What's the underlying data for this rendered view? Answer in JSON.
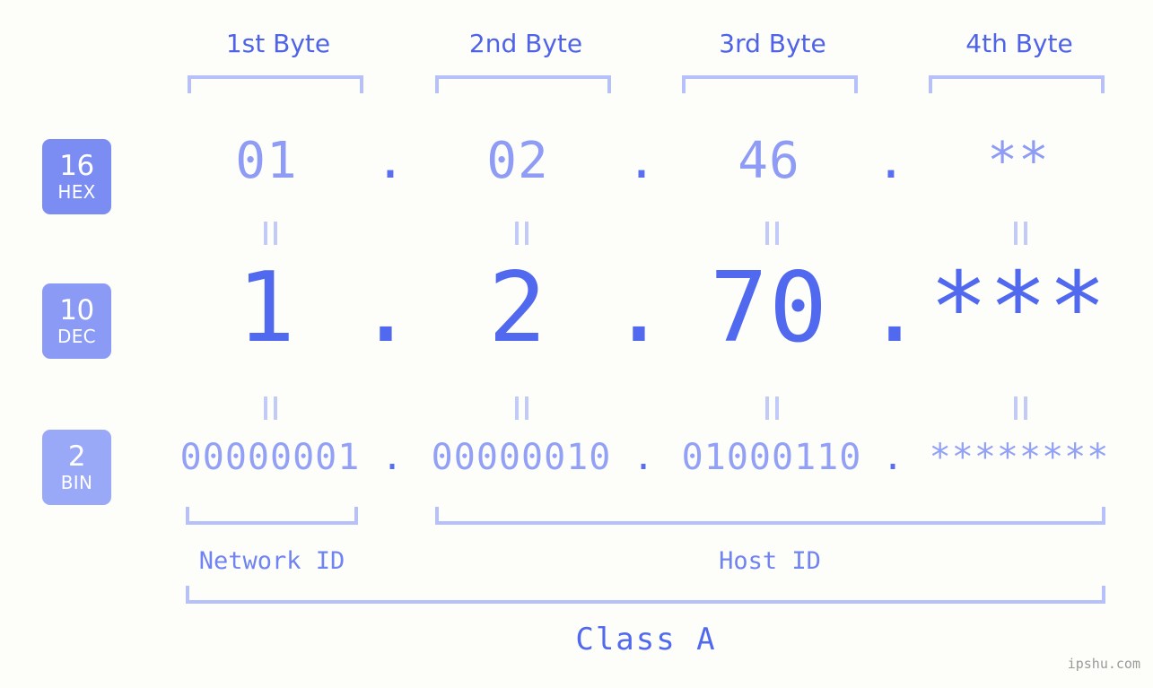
{
  "meta": {
    "background_color": "#fdfdfa",
    "accent_strong": "#5169ef",
    "accent_mid": "#8e9cf5",
    "accent_light": "#b6c0fb",
    "watermark": "ipshu.com"
  },
  "columns": [
    {
      "label": "1st Byte"
    },
    {
      "label": "2nd Byte"
    },
    {
      "label": "3rd Byte"
    },
    {
      "label": "4th Byte"
    }
  ],
  "bases": [
    {
      "number": "16",
      "name": "HEX",
      "color": "#7b8cf2"
    },
    {
      "number": "10",
      "name": "DEC",
      "color": "#8b9bf5"
    },
    {
      "number": "2",
      "name": "BIN",
      "color": "#9aa9f7"
    }
  ],
  "rows": {
    "hex": {
      "base_number": "16",
      "base_name": "HEX",
      "values": [
        "01",
        "02",
        "46",
        "**"
      ],
      "separator": "."
    },
    "dec": {
      "base_number": "10",
      "base_name": "DEC",
      "values": [
        "1",
        "2",
        "70",
        "***"
      ],
      "separator": "."
    },
    "bin": {
      "base_number": "2",
      "base_name": "BIN",
      "values": [
        "00000001",
        "00000010",
        "01000110",
        "********"
      ],
      "separator": "."
    }
  },
  "equality_symbol": "=",
  "id_sections": [
    {
      "label": "Network ID"
    },
    {
      "label": "Host ID"
    }
  ],
  "class_section": {
    "label": "Class A"
  }
}
